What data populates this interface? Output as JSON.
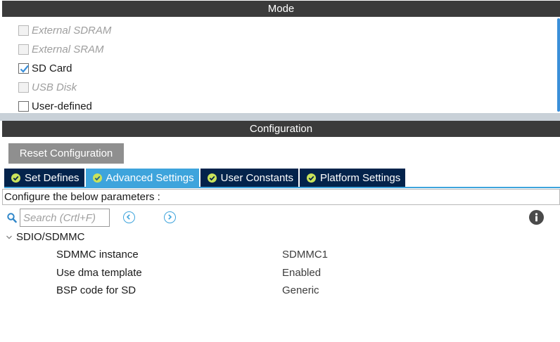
{
  "mode": {
    "title": "Mode",
    "options": [
      {
        "label": "External SDRAM",
        "checked": false,
        "enabled": false
      },
      {
        "label": "External SRAM",
        "checked": false,
        "enabled": false
      },
      {
        "label": "SD Card",
        "checked": true,
        "enabled": true
      },
      {
        "label": "USB Disk",
        "checked": false,
        "enabled": false
      },
      {
        "label": "User-defined",
        "checked": false,
        "enabled": true
      }
    ]
  },
  "configuration": {
    "title": "Configuration",
    "reset_label": "Reset Configuration",
    "tabs": [
      {
        "label": "Set Defines",
        "active": false
      },
      {
        "label": "Advanced Settings",
        "active": true
      },
      {
        "label": "User Constants",
        "active": false
      },
      {
        "label": "Platform Settings",
        "active": false
      }
    ],
    "description": "Configure the below parameters :",
    "search_placeholder": "Search (Crtl+F)",
    "group": {
      "title": "SDIO/SDMMC",
      "params": [
        {
          "name": "SDMMC instance",
          "value": "SDMMC1"
        },
        {
          "name": "Use dma template",
          "value": "Enabled"
        },
        {
          "name": "BSP code for SD",
          "value": "Generic"
        }
      ]
    }
  },
  "colors": {
    "header_bg": "#3b3b3b",
    "tab_bg": "#03234b",
    "tab_active_bg": "#3ea4dc",
    "check_icon": "#c9e35b",
    "accent": "#3a8fd9"
  },
  "icons": {
    "search": "search-icon",
    "prev": "chevron-left-circle-icon",
    "next": "chevron-right-circle-icon",
    "info": "info-icon",
    "tree_toggle": "chevron-down-icon",
    "tab_status": "check-circle-icon",
    "checkbox_checked": "checkmark-icon"
  }
}
